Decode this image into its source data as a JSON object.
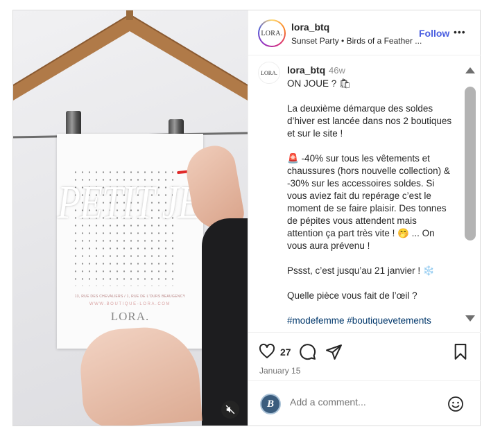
{
  "media": {
    "overlay_title": "PETIT JEU",
    "poster_address": "13, RUE DES CHEVALIERS / 1, RUE DE L'OURS BEAUGENCY",
    "poster_url": "WWW.BOUTIQUE-LORA.COM",
    "poster_logo": "LORA.",
    "mute_icon": "speaker-muted-icon"
  },
  "header": {
    "avatar_text": "LORA.",
    "username": "lora_btq",
    "subtitle": "Sunset Party • Birds of a Feather ...",
    "follow_label": "Follow",
    "more_label": "•••"
  },
  "caption": {
    "avatar_text": "LORA.",
    "username": "lora_btq",
    "time": "46w",
    "text": "ON JOUE ? 🛍\n\nLa deuxième démarque des soldes d’hiver est lancée dans nos 2 boutiques et sur le site !\n\n🚨 -40% sur tous les vêtements et chaussures (hors nouvelle collection) & -30% sur les accessoires soldes. Si vous aviez fait du repérage c’est le moment de se faire plaisir. Des tonnes de pépites vous attendent mais attention ça part très vite ! 🤭 ... On vous aura prévenu !\n\nPssst, c’est jusqu’au 21 janvier ! ❄️\n\nQuelle pièce vous fait de l’œil ?\n\n",
    "hashtags": "#modefemme #boutiquevetements #beaugency #orleans #pretaporter #n"
  },
  "actions": {
    "like_count": "27",
    "date": "January 15"
  },
  "comment": {
    "avatar_letter": "B",
    "placeholder": "Add a comment..."
  },
  "colors": {
    "follow": "#4a5ee0",
    "hashtag": "#00376b",
    "secondary_text": "#737373"
  }
}
